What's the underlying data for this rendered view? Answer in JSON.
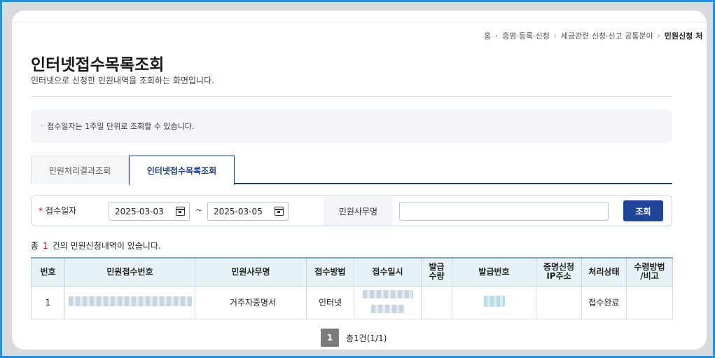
{
  "breadcrumb": {
    "items": [
      "홈",
      "증명·등록·신청",
      "세금관련 신청·신고 공통분야",
      "민원신청 처"
    ],
    "sep": "›"
  },
  "page": {
    "title": "인터넷접수목록조회",
    "description": "인터넷으로 신청한 민원내역을 조회하는 화면입니다."
  },
  "notice": {
    "bullet": "·",
    "text": "접수일자는 1주일 단위로 조회할 수 있습니다."
  },
  "tabs": [
    {
      "label": "민원처리결과조회",
      "active": false
    },
    {
      "label": "인터넷접수목록조회",
      "active": true
    }
  ],
  "search": {
    "required_mark": "*",
    "date_label": "접수일자",
    "date_from": "2025-03-03",
    "date_to": "2025-03-05",
    "tilde": "~",
    "office_label": "민원사무명",
    "office_value": "",
    "button": "조회"
  },
  "count": {
    "prefix": "총",
    "value": "1",
    "suffix": "건의 민원신청내역이 있습니다."
  },
  "table": {
    "headers": [
      "번호",
      "민원접수번호",
      "민원사무명",
      "접수방법",
      "접수일시",
      "발급\n수량",
      "발급번호",
      "증명신청\nIP주소",
      "처리상태",
      "수령방법\n/비고"
    ],
    "rows": [
      {
        "no": "1",
        "receipt_no": "",
        "office": "거주자증명서",
        "method": "인터넷",
        "datetime": "",
        "qty": "",
        "issue_no": "",
        "ip": "",
        "status": "접수완료",
        "remark": ""
      }
    ]
  },
  "pagination": {
    "current": "1",
    "summary": "총1건(1/1)"
  },
  "colors": {
    "primary": "#1f4596",
    "tab_active": "#1f3d7a",
    "required": "#d0021b",
    "table_header_bg": "#e7f2f7"
  }
}
